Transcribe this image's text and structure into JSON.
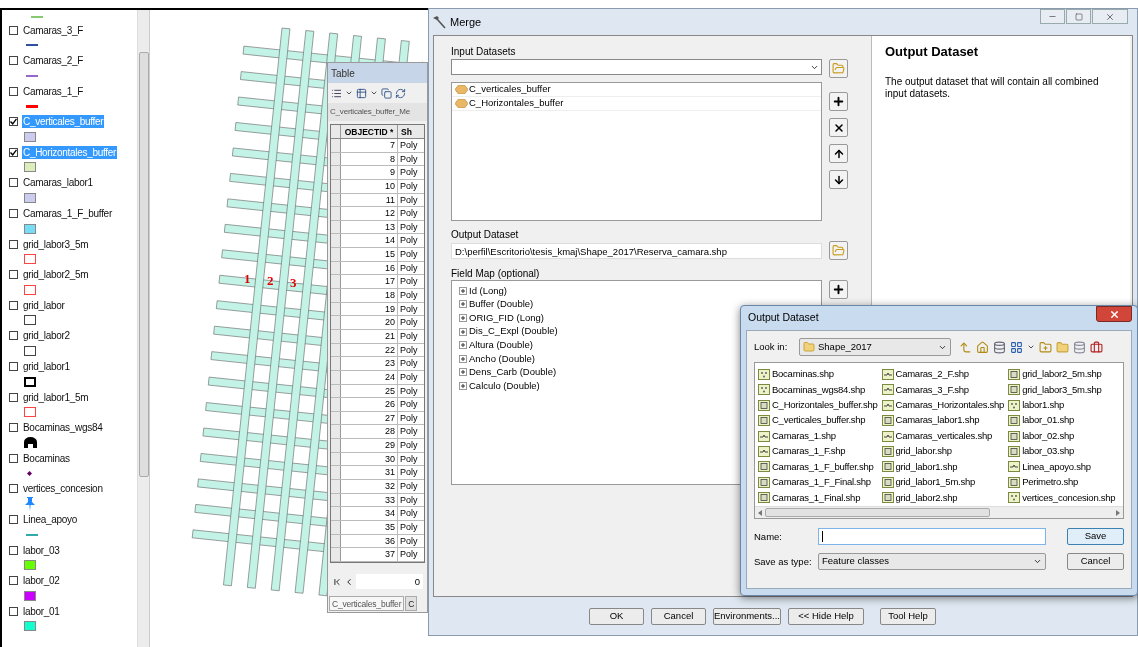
{
  "toc": {
    "top_swatch": {
      "kind": "line",
      "color": "#88c870"
    },
    "layers": [
      {
        "name": "Camaras_3_F",
        "checked": false,
        "selected": false,
        "swatch": {
          "kind": "line",
          "color": "#2f4f9f"
        }
      },
      {
        "name": "Camaras_2_F",
        "checked": false,
        "selected": false,
        "swatch": {
          "kind": "line",
          "color": "#9966cc"
        }
      },
      {
        "name": "Camaras_1_F",
        "checked": false,
        "selected": false,
        "swatch": {
          "kind": "thick_line",
          "color": "#ff0000"
        }
      },
      {
        "name": "C_verticales_buffer",
        "checked": true,
        "selected": true,
        "swatch": {
          "kind": "fill",
          "color": "#ccccf0"
        }
      },
      {
        "name": "C_Horizontales_buffer",
        "checked": true,
        "selected": true,
        "swatch": {
          "kind": "fill",
          "color": "#ddedbb"
        }
      },
      {
        "name": "Camaras_labor1",
        "checked": false,
        "selected": false,
        "swatch": {
          "kind": "fill",
          "color": "#ccccf0"
        }
      },
      {
        "name": "Camaras_1_F_buffer",
        "checked": false,
        "selected": false,
        "swatch": {
          "kind": "fill",
          "color": "#77ddf5"
        }
      },
      {
        "name": "grid_labor3_5m",
        "checked": false,
        "selected": false,
        "swatch": {
          "kind": "outline",
          "color": "#ff4444"
        }
      },
      {
        "name": "grid_labor2_5m",
        "checked": false,
        "selected": false,
        "swatch": {
          "kind": "outline",
          "color": "#ff4444"
        }
      },
      {
        "name": "grid_labor",
        "checked": false,
        "selected": false,
        "swatch": {
          "kind": "outline",
          "color": "#444444"
        }
      },
      {
        "name": "grid_labor2",
        "checked": false,
        "selected": false,
        "swatch": {
          "kind": "outline",
          "color": "#444444"
        }
      },
      {
        "name": "grid_labor1",
        "checked": false,
        "selected": false,
        "swatch": {
          "kind": "thick_outline",
          "color": "#000000"
        }
      },
      {
        "name": "grid_labor1_5m",
        "checked": false,
        "selected": false,
        "swatch": {
          "kind": "outline",
          "color": "#ff4444"
        }
      },
      {
        "name": "Bocaminas_wgs84",
        "checked": false,
        "selected": false,
        "swatch": {
          "kind": "arch",
          "color": "#000000"
        }
      },
      {
        "name": "Bocaminas",
        "checked": false,
        "selected": false,
        "swatch": {
          "kind": "dot",
          "color": "#660066"
        }
      },
      {
        "name": "vertices_concesion",
        "checked": false,
        "selected": false,
        "swatch": {
          "kind": "pin",
          "color": "#1e88ff"
        }
      },
      {
        "name": "Linea_apoyo",
        "checked": false,
        "selected": false,
        "swatch": {
          "kind": "line",
          "color": "#33aaaa"
        }
      },
      {
        "name": "labor_03",
        "checked": false,
        "selected": false,
        "swatch": {
          "kind": "fill",
          "color": "#66ff00"
        }
      },
      {
        "name": "labor_02",
        "checked": false,
        "selected": false,
        "swatch": {
          "kind": "fill",
          "color": "#cc00ff"
        }
      },
      {
        "name": "labor_01",
        "checked": false,
        "selected": false,
        "swatch": {
          "kind": "fill",
          "color": "#11ffcc"
        }
      }
    ]
  },
  "map": {
    "labels": [
      "1",
      "2",
      "3"
    ]
  },
  "table_window": {
    "title": "Table",
    "layer": "C_verticales_buffer_Me",
    "columns": [
      "OBJECTID *",
      "Sh"
    ],
    "rows": [
      [
        "7",
        "Poly"
      ],
      [
        "8",
        "Poly"
      ],
      [
        "9",
        "Poly"
      ],
      [
        "10",
        "Poly"
      ],
      [
        "11",
        "Poly"
      ],
      [
        "12",
        "Poly"
      ],
      [
        "13",
        "Poly"
      ],
      [
        "14",
        "Poly"
      ],
      [
        "15",
        "Poly"
      ],
      [
        "16",
        "Poly"
      ],
      [
        "17",
        "Poly"
      ],
      [
        "18",
        "Poly"
      ],
      [
        "19",
        "Poly"
      ],
      [
        "20",
        "Poly"
      ],
      [
        "21",
        "Poly"
      ],
      [
        "22",
        "Poly"
      ],
      [
        "23",
        "Poly"
      ],
      [
        "24",
        "Poly"
      ],
      [
        "25",
        "Poly"
      ],
      [
        "26",
        "Poly"
      ],
      [
        "27",
        "Poly"
      ],
      [
        "28",
        "Poly"
      ],
      [
        "29",
        "Poly"
      ],
      [
        "30",
        "Poly"
      ],
      [
        "31",
        "Poly"
      ],
      [
        "32",
        "Poly"
      ],
      [
        "33",
        "Poly"
      ],
      [
        "34",
        "Poly"
      ],
      [
        "35",
        "Poly"
      ],
      [
        "36",
        "Poly"
      ],
      [
        "37",
        "Poly"
      ]
    ],
    "record": "0",
    "tabs": [
      {
        "label": "C_verticales_buffer",
        "selected": true
      },
      {
        "label": "C",
        "selected": false
      }
    ]
  },
  "merge": {
    "title": "Merge",
    "input_label": "Input Datasets",
    "inputs": [
      "C_verticales_buffer",
      "C_Horizontales_buffer"
    ],
    "output_label": "Output Dataset",
    "output_value": "D:\\perfil\\Escritorio\\tesis_kmaj\\Shape_2017\\Reserva_camara.shp",
    "field_map_label": "Field Map (optional)",
    "fields": [
      "Id (Long)",
      "Buffer (Double)",
      "ORIG_FID (Long)",
      "Dis_C_Expl (Double)",
      "Altura (Double)",
      "Ancho (Double)",
      "Dens_Carb (Double)",
      "Calculo (Double)"
    ],
    "buttons": [
      "OK",
      "Cancel",
      "Environments...",
      "<< Hide Help",
      "Tool Help"
    ],
    "help": {
      "title": "Output Dataset",
      "text": "The output dataset that will contain all combined input datasets."
    }
  },
  "save_dialog": {
    "title": "Output Dataset",
    "look_in_label": "Look in:",
    "look_in": "Shape_2017",
    "files": [
      {
        "name": "Bocaminas.shp",
        "kind": "point"
      },
      {
        "name": "Bocaminas_wgs84.shp",
        "kind": "point"
      },
      {
        "name": "C_Horizontales_buffer.shp",
        "kind": "polygon"
      },
      {
        "name": "C_verticales_buffer.shp",
        "kind": "polygon"
      },
      {
        "name": "Camaras_1.shp",
        "kind": "line"
      },
      {
        "name": "Camaras_1_F.shp",
        "kind": "line"
      },
      {
        "name": "Camaras_1_F_buffer.shp",
        "kind": "polygon"
      },
      {
        "name": "Camaras_1_F_Final.shp",
        "kind": "polygon"
      },
      {
        "name": "Camaras_1_Final.shp",
        "kind": "polygon"
      },
      {
        "name": "Camaras_2_F.shp",
        "kind": "line"
      },
      {
        "name": "Camaras_3_F.shp",
        "kind": "line"
      },
      {
        "name": "Camaras_Horizontales.shp",
        "kind": "line"
      },
      {
        "name": "Camaras_labor1.shp",
        "kind": "polygon"
      },
      {
        "name": "Camaras_verticales.shp",
        "kind": "line"
      },
      {
        "name": "grid_labor.shp",
        "kind": "polygon"
      },
      {
        "name": "grid_labor1.shp",
        "kind": "polygon"
      },
      {
        "name": "grid_labor1_5m.shp",
        "kind": "polygon"
      },
      {
        "name": "grid_labor2.shp",
        "kind": "polygon"
      },
      {
        "name": "grid_labor2_5m.shp",
        "kind": "polygon"
      },
      {
        "name": "grid_labor3_5m.shp",
        "kind": "polygon"
      },
      {
        "name": "labor1.shp",
        "kind": "point"
      },
      {
        "name": "labor_01.shp",
        "kind": "polygon"
      },
      {
        "name": "labor_02.shp",
        "kind": "polygon"
      },
      {
        "name": "labor_03.shp",
        "kind": "polygon"
      },
      {
        "name": "Linea_apoyo.shp",
        "kind": "line"
      },
      {
        "name": "Perimetro.shp",
        "kind": "polygon"
      },
      {
        "name": "vertices_concesion.shp",
        "kind": "point"
      }
    ],
    "name_label": "Name:",
    "type_label": "Save as type:",
    "type_value": "Feature classes",
    "buttons": [
      {
        "label": "Save",
        "default": true
      },
      {
        "label": "Cancel",
        "default": false
      }
    ]
  }
}
